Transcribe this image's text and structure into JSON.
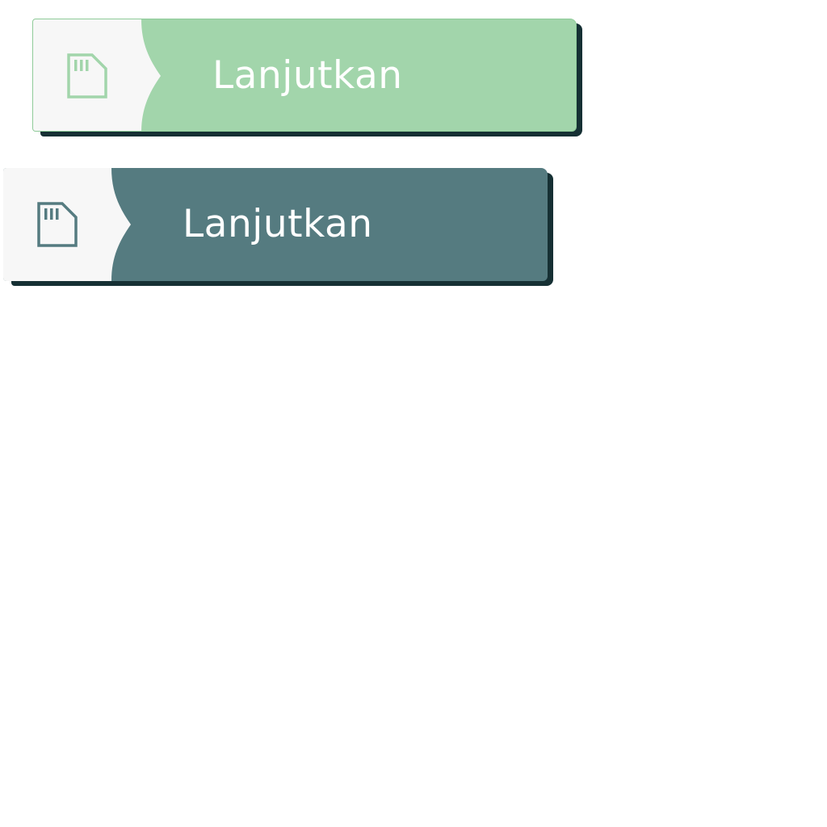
{
  "buttons": [
    {
      "label": "Lanjutkan",
      "icon": "sd-card-icon",
      "variant": "light-green",
      "accent_color": "#a2d5ab",
      "icon_color": "#a2d5ab"
    },
    {
      "label": "Lanjutkan",
      "icon": "sd-card-icon",
      "variant": "teal",
      "accent_color": "#557b80",
      "icon_color": "#557b80"
    }
  ]
}
